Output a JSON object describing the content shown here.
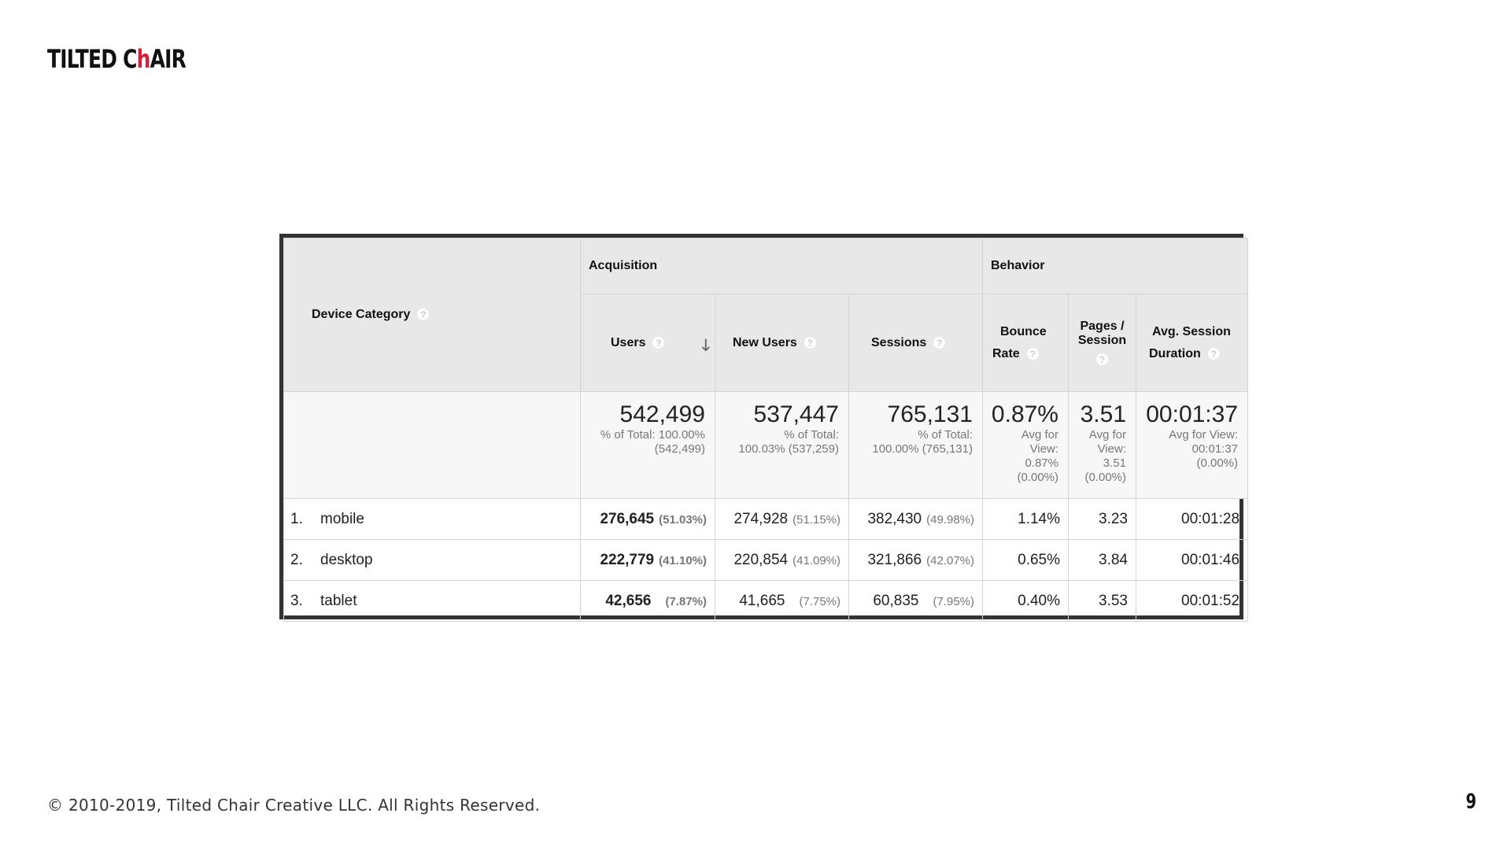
{
  "brand": {
    "logo_part1": "TILTED C",
    "logo_accent": "h",
    "logo_part2": "AIR"
  },
  "footer": {
    "copyright": "© 2010-2019, Tilted Chair Creative LLC. All Rights Reserved.",
    "page_number": "9"
  },
  "table": {
    "dimension_header": "Device Category",
    "group_acquisition": "Acquisition",
    "group_behavior": "Behavior",
    "columns": {
      "users": "Users",
      "new_users": "New Users",
      "sessions": "Sessions",
      "bounce_rate_line1": "Bounce",
      "bounce_rate_line2": "Rate",
      "pages_line1": "Pages /",
      "pages_line2": "Session",
      "duration_line1": "Avg. Session",
      "duration_line2": "Duration"
    },
    "totals": {
      "users": "542,499",
      "users_line1": "% of Total: 100.00%",
      "users_line2": "(542,499)",
      "new_users": "537,447",
      "new_users_line1": "% of Total:",
      "new_users_line2": "100.03% (537,259)",
      "sessions": "765,131",
      "sessions_line1": "% of Total:",
      "sessions_line2": "100.00% (765,131)",
      "bounce_rate": "0.87%",
      "bounce_line1": "Avg for",
      "bounce_line2": "View:",
      "bounce_line3": "0.87%",
      "bounce_line4": "(0.00%)",
      "pages": "3.51",
      "pages_line1": "Avg for",
      "pages_line2": "View:",
      "pages_line3": "3.51",
      "pages_line4": "(0.00%)",
      "duration": "00:01:37",
      "duration_line1": "Avg for View:",
      "duration_line2": "00:01:37",
      "duration_line3": "(0.00%)"
    },
    "rows": [
      {
        "rank": "1.",
        "device": "mobile",
        "users": "276,645",
        "users_pct": "(51.03%)",
        "new_users": "274,928",
        "new_users_pct": "(51.15%)",
        "sessions": "382,430",
        "sessions_pct": "(49.98%)",
        "bounce_rate": "1.14%",
        "pages": "3.23",
        "duration": "00:01:28"
      },
      {
        "rank": "2.",
        "device": "desktop",
        "users": "222,779",
        "users_pct": "(41.10%)",
        "new_users": "220,854",
        "new_users_pct": "(41.09%)",
        "sessions": "321,866",
        "sessions_pct": "(42.07%)",
        "bounce_rate": "0.65%",
        "pages": "3.84",
        "duration": "00:01:46"
      },
      {
        "rank": "3.",
        "device": "tablet",
        "users": "42,656",
        "users_pct": "(7.87%)",
        "new_users": "41,665",
        "new_users_pct": "(7.75%)",
        "sessions": "60,835",
        "sessions_pct": "(7.95%)",
        "bounce_rate": "0.40%",
        "pages": "3.53",
        "duration": "00:01:52"
      }
    ]
  }
}
